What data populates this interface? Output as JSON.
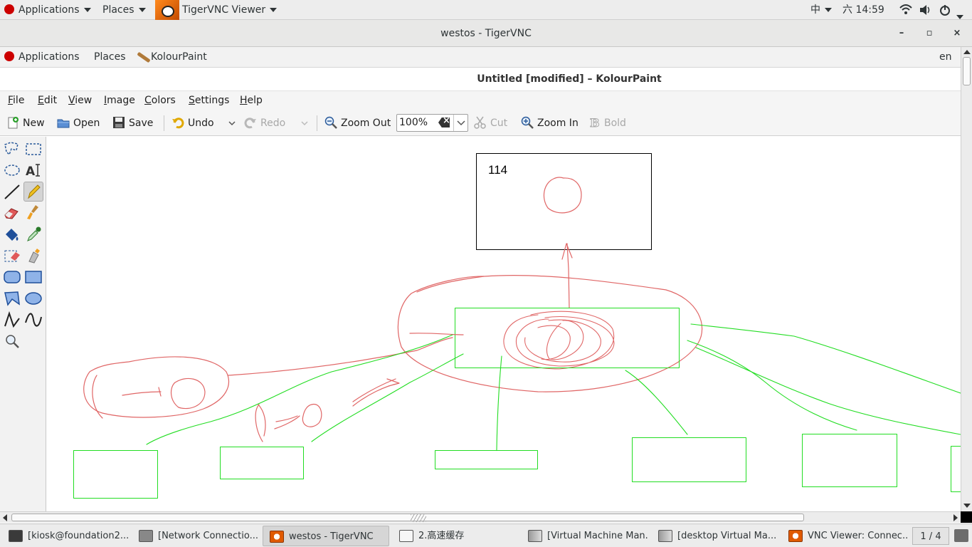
{
  "topbar": {
    "applications": "Applications",
    "places": "Places",
    "app_name": "TigerVNC Viewer",
    "input_method": "中",
    "clock": "六 14:59"
  },
  "vnc_window": {
    "title": "westos - TigerVNC",
    "minimize": "–",
    "maximize": "▫",
    "close": "×"
  },
  "remote_panel": {
    "applications": "Applications",
    "places": "Places",
    "app_name": "KolourPaint",
    "lang": "en"
  },
  "kolourpaint": {
    "title": "Untitled [modified] – KolourPaint",
    "menu": [
      "File",
      "Edit",
      "View",
      "Image",
      "Colors",
      "Settings",
      "Help"
    ],
    "menu_accel": [
      "F",
      "E",
      "V",
      "I",
      "C",
      "S",
      "H"
    ],
    "menu_rest": [
      "ile",
      "dit",
      "iew",
      "mage",
      "olors",
      "ettings",
      "elp"
    ],
    "toolbar": {
      "new": "New",
      "open": "Open",
      "save": "Save",
      "undo": "Undo",
      "redo": "Redo",
      "zoom_out": "Zoom Out",
      "zoom_value": "100%",
      "cut": "Cut",
      "zoom_in": "Zoom In",
      "bold": "Bold"
    },
    "canvas_text": "114",
    "colors": {
      "sketch_red": "#e06666",
      "sketch_green": "#22dd22",
      "box_black": "#000000"
    }
  },
  "taskbar": {
    "tasks": [
      "[kiosk@foundation2...",
      "[Network Connectio...",
      "westos - TigerVNC",
      "2.高速缓存",
      "[Virtual Machine Man...",
      "[desktop Virtual Ma...",
      "VNC Viewer: Connec..."
    ],
    "pager": "1 / 4"
  }
}
